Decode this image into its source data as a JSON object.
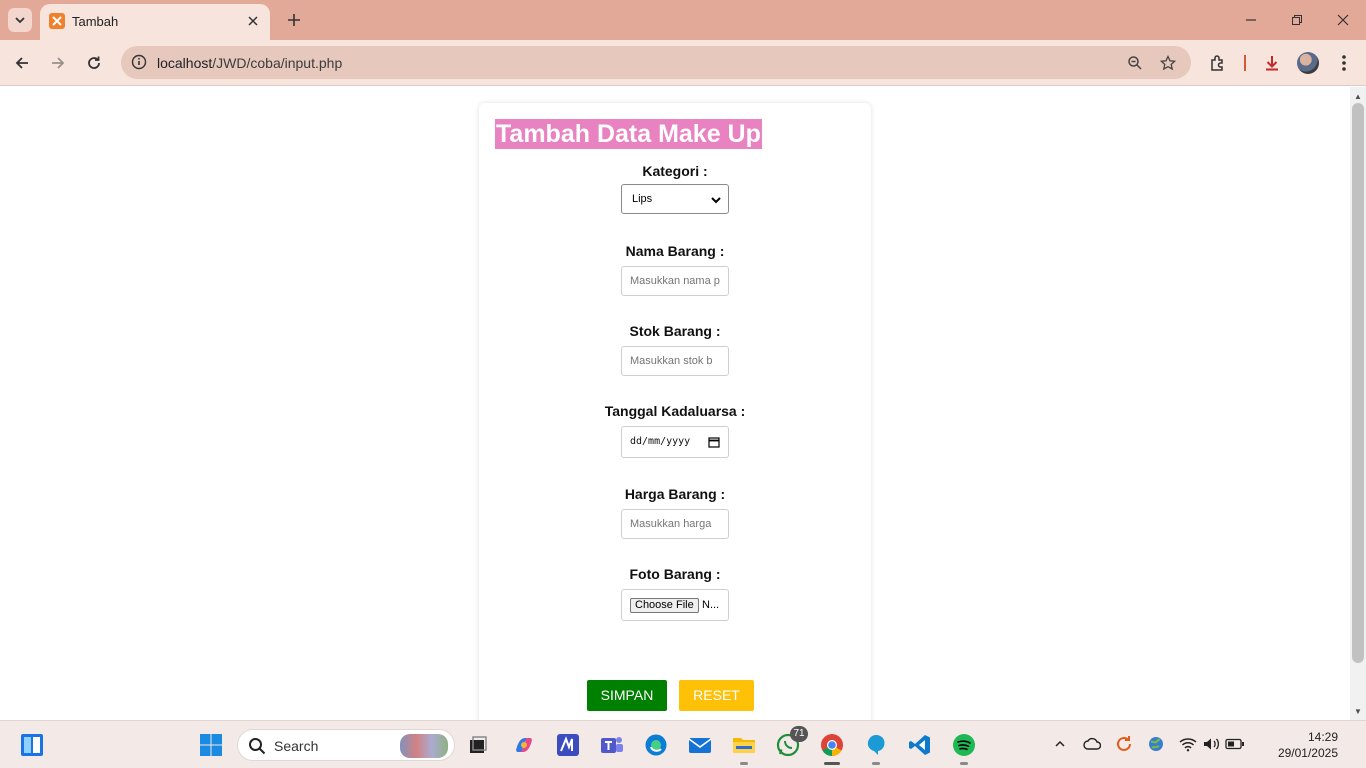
{
  "browser": {
    "tab_title": "Tambah",
    "url_host": "localhost",
    "url_path": "/JWD/coba/input.php"
  },
  "form": {
    "title": "Tambah Data Make Up",
    "kategori_label": "Kategori :",
    "kategori_value": "Lips",
    "nama_label": "Nama Barang :",
    "nama_placeholder": "Masukkan nama pr",
    "stok_label": "Stok Barang :",
    "stok_placeholder": "Masukkan stok b",
    "tanggal_label": "Tanggal Kadaluarsa :",
    "tanggal_value": "dd/mm/yyyy",
    "harga_label": "Harga Barang :",
    "harga_placeholder": "Masukkan harga",
    "foto_label": "Foto Barang :",
    "file_button": "Choose File",
    "file_status": "N...",
    "save_label": "SIMPAN",
    "reset_label": "RESET"
  },
  "taskbar": {
    "search_label": "Search",
    "whatsapp_badge": "71",
    "time": "14:29",
    "date": "29/01/2025"
  },
  "colors": {
    "title_bg": "#e882c0",
    "save_bg": "#008000",
    "reset_bg": "#ffc107",
    "chrome_frame": "#e3a998"
  }
}
